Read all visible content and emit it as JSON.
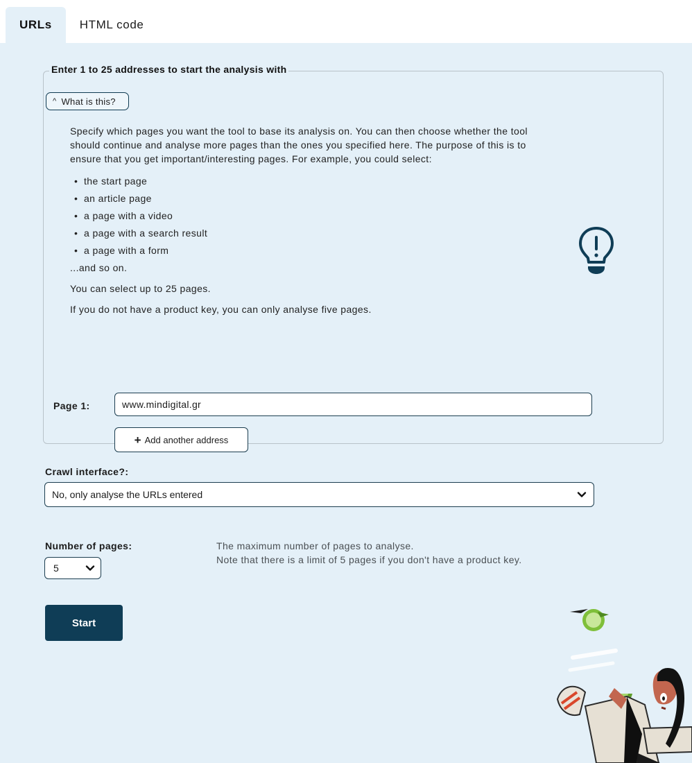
{
  "tabs": [
    {
      "label": "URLs",
      "active": true
    },
    {
      "label": "HTML code",
      "active": false
    }
  ],
  "fieldset": {
    "legend": "Enter 1 to 25 addresses to start the analysis with",
    "toggle_label": "What is this?",
    "toggle_icon": "chevron-up-icon",
    "info_intro": "Specify which pages you want the tool to base its analysis on. You can then choose whether the tool should continue and analyse more pages than the ones you specified here. The purpose of this is to ensure that you get important/interesting pages. For example, you could select:",
    "examples": [
      "the start page",
      "an article page",
      "a page with a video",
      "a page with a search result",
      "a page with a form"
    ],
    "and_so_on": "...and so on.",
    "limit_text": "You can select up to 25 pages.",
    "product_key_text": "If you do not have a product key, you can only analyse five pages.",
    "page_label": "Page 1:",
    "page_value": "www.mindigital.gr",
    "add_button": "Add another address"
  },
  "crawl": {
    "label": "Crawl interface?:",
    "selected": "No, only analyse the URLs entered"
  },
  "pages": {
    "label": "Number of pages:",
    "selected": "5",
    "help_line1": "The maximum number of pages to analyse.",
    "help_line2": "Note that there is a limit of 5 pages if you don't have a product key."
  },
  "start_button": "Start",
  "colors": {
    "panel_bg": "#e4f0f8",
    "primary": "#0f3d56"
  }
}
